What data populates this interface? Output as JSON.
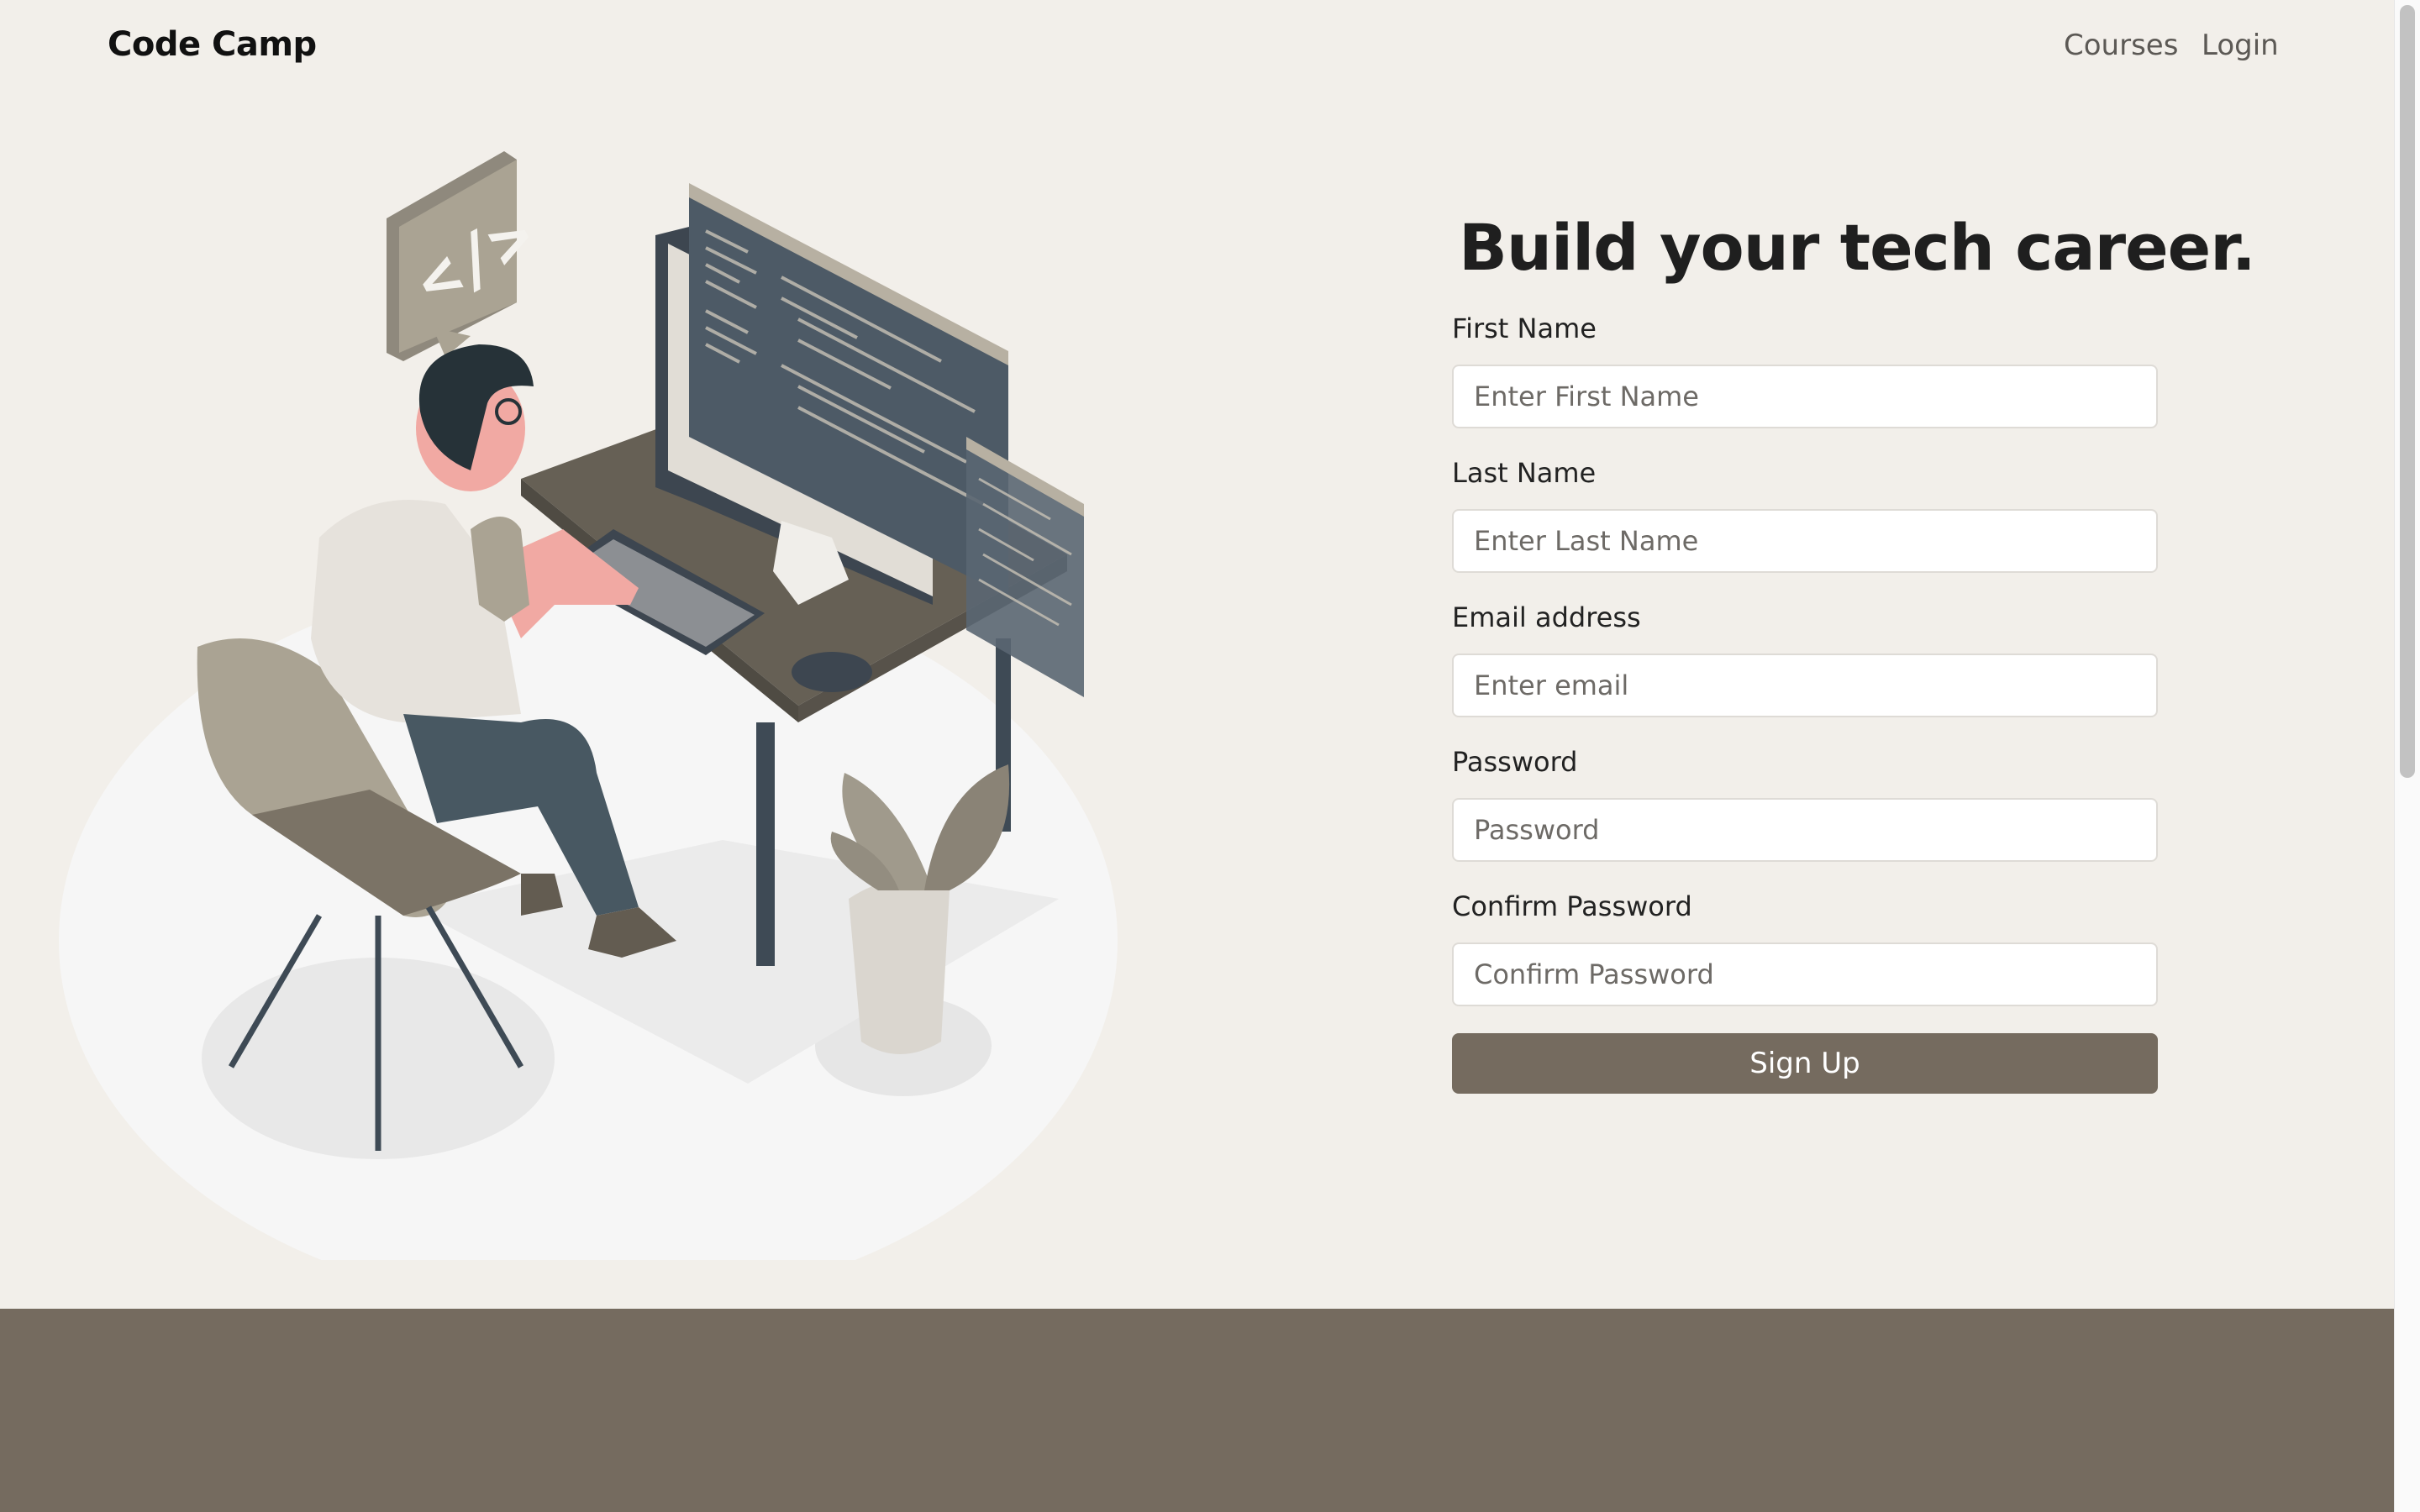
{
  "nav": {
    "brand": "Code Camp",
    "links": [
      "Courses",
      "Login"
    ]
  },
  "hero": {
    "headline": "Build your tech career.",
    "illustration_icon": "code-bubble-icon"
  },
  "form": {
    "fields": [
      {
        "label": "First Name",
        "placeholder": "Enter First Name",
        "value": ""
      },
      {
        "label": "Last Name",
        "placeholder": "Enter Last Name",
        "value": ""
      },
      {
        "label": "Email address",
        "placeholder": "Enter email",
        "value": ""
      },
      {
        "label": "Password",
        "placeholder": "Password",
        "value": ""
      },
      {
        "label": "Confirm Password",
        "placeholder": "Confirm Password",
        "value": ""
      }
    ],
    "submit_label": "Sign Up"
  },
  "colors": {
    "background": "#f2efea",
    "accent": "#756b5f",
    "text": "#1f1f1f"
  }
}
